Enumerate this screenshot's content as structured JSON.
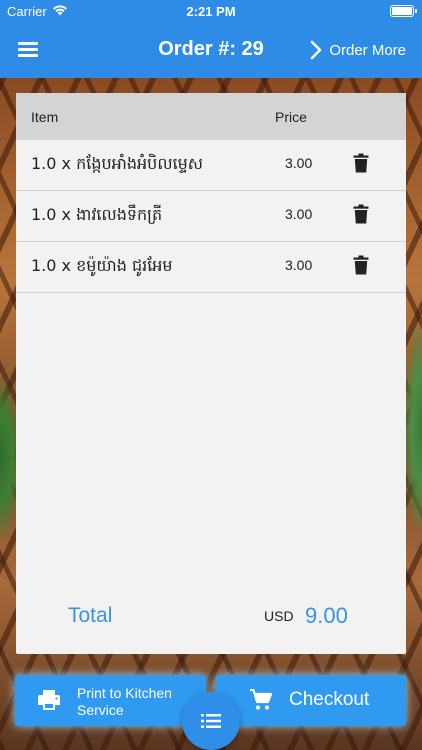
{
  "status_bar": {
    "carrier": "Carrier",
    "time": "2:21 PM"
  },
  "header": {
    "title": "Order #: 29",
    "order_more_label": "Order More",
    "accent_color": "#2e8ce6"
  },
  "table": {
    "columns": [
      "Item",
      "Price"
    ],
    "rows": [
      {
        "name": "1.0 x កង្កែបអាំងអំបិលម្ទេស",
        "price": "3.00"
      },
      {
        "name": "1.0 x ងាវលេងទឹកត្រី",
        "price": "3.00"
      },
      {
        "name": "1.0 x ខម៉ូយ៉ាង ជូរអែម",
        "price": "3.00"
      }
    ]
  },
  "totals": {
    "label": "Total",
    "currency": "USD",
    "amount": "9.00"
  },
  "actions": {
    "print_label": "Print to Kitchen Service",
    "checkout_label": "Checkout"
  },
  "icons": {
    "menu": "menu-icon",
    "order_more": "chevron-right-icon",
    "row_delete": "trash-icon",
    "print": "printer-icon",
    "checkout": "cart-icon",
    "fab": "list-icon"
  }
}
